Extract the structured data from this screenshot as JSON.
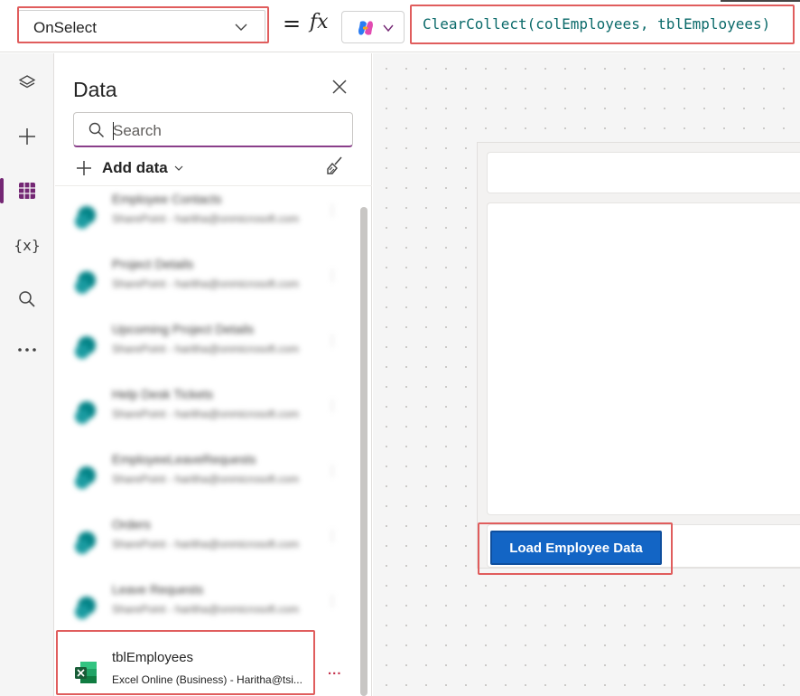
{
  "formula_bar": {
    "property": "OnSelect",
    "equals": "=",
    "fx": "fx",
    "formula": "ClearCollect(colEmployees, tblEmployees)"
  },
  "rail": {
    "items": [
      {
        "icon": "layers-icon"
      },
      {
        "icon": "plus-icon"
      },
      {
        "icon": "data-grid-icon",
        "active": true
      },
      {
        "icon": "variables-icon",
        "label": "{x}"
      },
      {
        "icon": "search-icon"
      },
      {
        "icon": "more-icon"
      }
    ]
  },
  "data_panel": {
    "title": "Data",
    "search_placeholder": "Search",
    "add_data_label": "Add data",
    "sources": [
      {
        "name": "Employee Contacts",
        "sub": "SharePoint - haritha@onmicrosoft.com",
        "blurred": true
      },
      {
        "name": "Project Details",
        "sub": "SharePoint - haritha@onmicrosoft.com",
        "blurred": true
      },
      {
        "name": "Upcoming Project Details",
        "sub": "SharePoint - haritha@onmicrosoft.com",
        "blurred": true
      },
      {
        "name": "Help Desk Tickets",
        "sub": "SharePoint - haritha@onmicrosoft.com",
        "blurred": true
      },
      {
        "name": "EmployeeLeaveRequests",
        "sub": "SharePoint - haritha@onmicrosoft.com",
        "blurred": true
      },
      {
        "name": "Orders",
        "sub": "SharePoint - haritha@onmicrosoft.com",
        "blurred": true
      },
      {
        "name": "Leave Requests",
        "sub": "SharePoint - haritha@onmicrosoft.com",
        "blurred": true
      }
    ],
    "selected_source": {
      "name": "tblEmployees",
      "sub": "Excel Online (Business) - Haritha@tsi...",
      "more": "..."
    }
  },
  "canvas": {
    "button_label": "Load Employee Data"
  },
  "colors": {
    "accent_purple": "#742774",
    "button_blue": "#1365c5",
    "highlight_red": "#e05d5d",
    "formula_teal": "#0b6a6a"
  }
}
